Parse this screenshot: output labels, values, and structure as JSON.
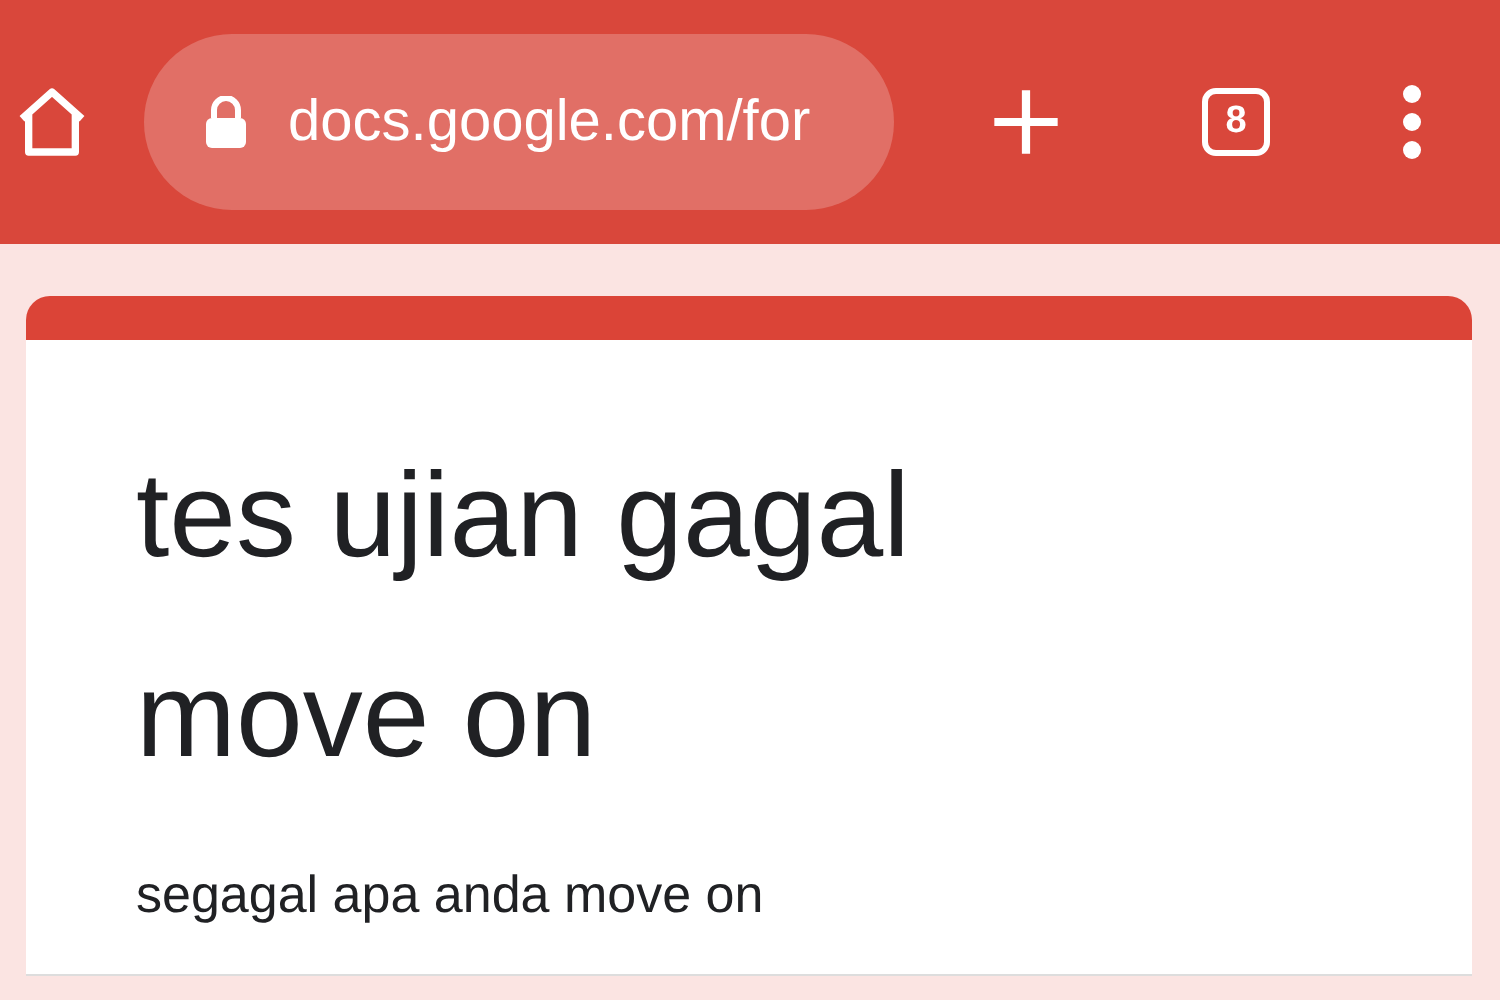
{
  "toolbar": {
    "url": "docs.google.com/for",
    "tab_count": "8"
  },
  "form": {
    "title": "tes ujian gagal move on",
    "description": "segagal apa anda move on"
  }
}
